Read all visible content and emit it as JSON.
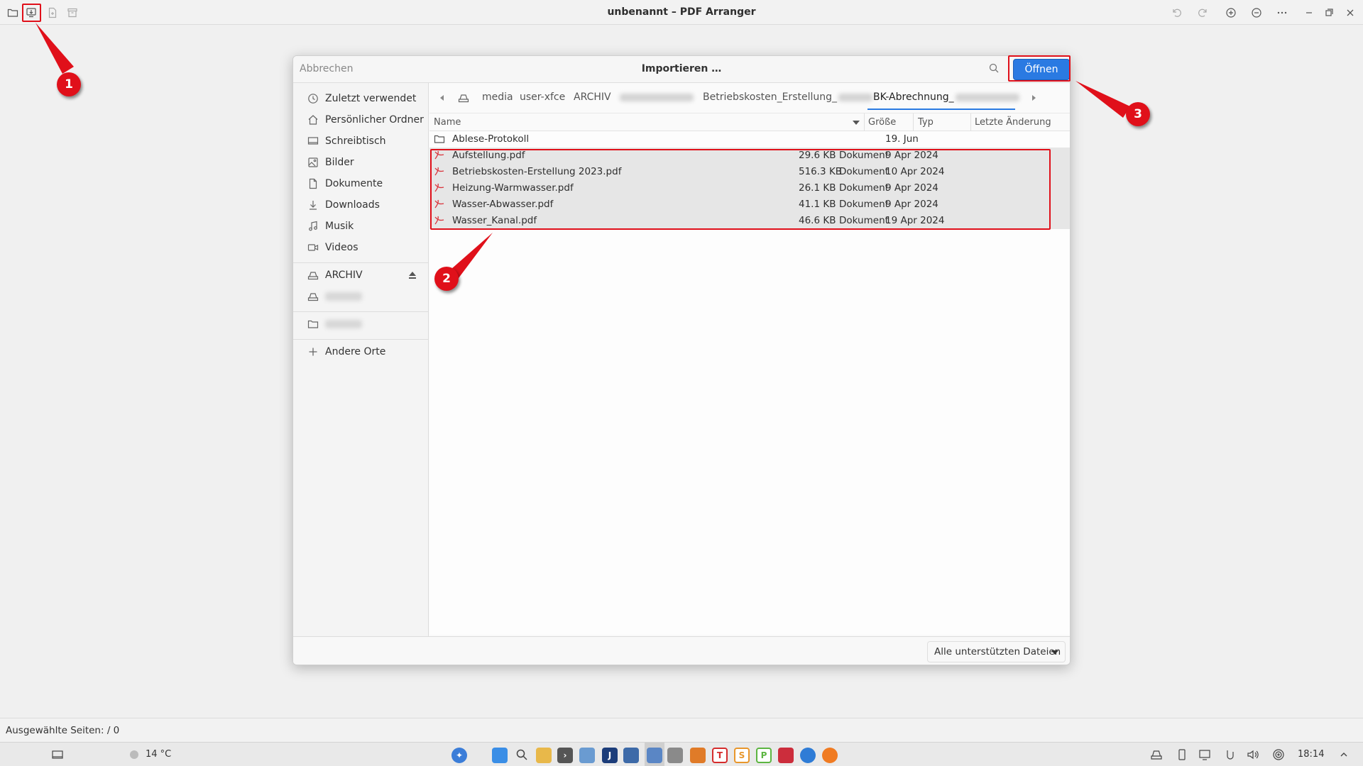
{
  "window": {
    "title": "unbenannt – PDF Arranger"
  },
  "dialog": {
    "title": "Importieren …",
    "cancel_label": "Abbrechen",
    "open_label": "Öffnen",
    "filter_label": "Alle unterstützten Dateien"
  },
  "sidebar": {
    "places": [
      {
        "label": "Zuletzt verwendet",
        "icon": "clock-icon"
      },
      {
        "label": "Persönlicher Ordner",
        "icon": "home-icon"
      },
      {
        "label": "Schreibtisch",
        "icon": "desktop-icon"
      },
      {
        "label": "Bilder",
        "icon": "image-icon"
      },
      {
        "label": "Dokumente",
        "icon": "document-icon"
      },
      {
        "label": "Downloads",
        "icon": "download-icon"
      },
      {
        "label": "Musik",
        "icon": "music-icon"
      },
      {
        "label": "Videos",
        "icon": "video-icon"
      }
    ],
    "devices": [
      {
        "label": "ARCHIV",
        "icon": "drive-icon"
      }
    ],
    "other_label": "Andere Orte"
  },
  "pathbar": {
    "segments": [
      "media",
      "user-xfce",
      "ARCHIV",
      "Betriebskosten_Erstellung_",
      "BK-Abrechnung_"
    ]
  },
  "columns": {
    "name": "Name",
    "size": "Größe",
    "type": "Typ",
    "modified": "Letzte Änderung"
  },
  "files": [
    {
      "name": "Ablese-Protokoll",
      "size": "",
      "type": "",
      "date": "19. Jun",
      "kind": "folder"
    },
    {
      "name": "Aufstellung.pdf",
      "size": "29.6 KB",
      "type": "Dokument",
      "date": "9 Apr 2024",
      "kind": "pdf"
    },
    {
      "name": "Betriebskosten-Erstellung 2023.pdf",
      "size": "516.3 KB",
      "type": "Dokument",
      "date": "10 Apr 2024",
      "kind": "pdf"
    },
    {
      "name": "Heizung-Warmwasser.pdf",
      "size": "26.1 KB",
      "type": "Dokument",
      "date": "9 Apr 2024",
      "kind": "pdf"
    },
    {
      "name": "Wasser-Abwasser.pdf",
      "size": "41.1 KB",
      "type": "Dokument",
      "date": "9 Apr 2024",
      "kind": "pdf"
    },
    {
      "name": "Wasser_Kanal.pdf",
      "size": "46.6 KB",
      "type": "Dokument",
      "date": "19 Apr 2024",
      "kind": "pdf"
    }
  ],
  "status": {
    "text": "Ausgewählte Seiten:  / 0"
  },
  "taskbar": {
    "weather": "14 °C",
    "clock": "18:14"
  },
  "annotations": [
    "1",
    "2",
    "3"
  ],
  "colors": {
    "accent": "#2a7ae2",
    "annotation": "#e0101a",
    "pdf_icon": "#d9323a"
  }
}
